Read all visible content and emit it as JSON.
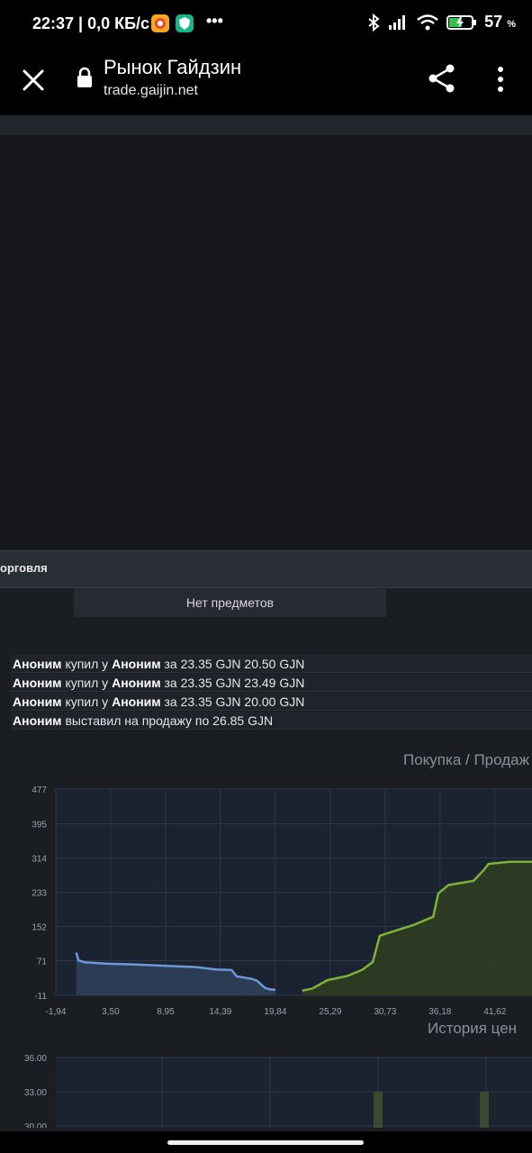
{
  "status_bar": {
    "time": "22:37",
    "speed": "0,0 КБ/с",
    "dots": "•••",
    "battery": "57",
    "battery_unit": "%"
  },
  "browser": {
    "title": "Рынок Гайдзин",
    "url": "trade.gaijin.net"
  },
  "trade_section": {
    "header": "орговля",
    "no_items": "Нет предметов"
  },
  "history": [
    {
      "user1": "Аноним",
      "action": "купил у",
      "user2": "Аноним",
      "rest": "за 23.35 GJN 20.50 GJN"
    },
    {
      "user1": "Аноним",
      "action": "купил у",
      "user2": "Аноним",
      "rest": "за 23.35 GJN 23.49 GJN"
    },
    {
      "user1": "Аноним",
      "action": "купил у",
      "user2": "Аноним",
      "rest": "за 23.35 GJN 20.00 GJN"
    },
    {
      "user1": "Аноним",
      "action": "выставил на продажу по 26.85 GJN",
      "user2": "",
      "rest": ""
    }
  ],
  "colors": {
    "buy_line": "#6e98d8",
    "buy_fill": "#2e3f5a",
    "sell_line": "#7fb23a",
    "sell_fill": "#2f3d22",
    "bar": "#3a4a2e"
  },
  "chart_data": [
    {
      "type": "area",
      "title": "Покупка / Продаж",
      "y_ticks": [
        "477",
        "395",
        "314",
        "233",
        "152",
        "71",
        "-11"
      ],
      "x_ticks": [
        "-1,94",
        "3,50",
        "8,95",
        "14,39",
        "19,84",
        "25,29",
        "30,73",
        "36,18",
        "41,62"
      ],
      "ylim": [
        -11,
        477
      ],
      "xlim": [
        -1.94,
        45.3
      ],
      "series": [
        {
          "x": [
            0.1,
            0.3,
            1.0,
            3.0,
            6.0,
            9.0,
            12.0,
            14.0,
            15.5,
            16.0,
            17.5,
            18.0,
            18.8,
            19.3,
            19.84
          ],
          "y": [
            90,
            72,
            67,
            64,
            62,
            59,
            56,
            50,
            49,
            34,
            28,
            24,
            7,
            3,
            2
          ]
        },
        {
          "x": [
            22.5,
            23.5,
            25.0,
            27.0,
            28.5,
            29.5,
            30.2,
            31.5,
            33.5,
            35.5,
            36.0,
            37.0,
            39.5,
            40.5,
            41.0,
            43.0,
            45.3
          ],
          "y": [
            0,
            5,
            25,
            35,
            50,
            68,
            130,
            140,
            155,
            175,
            230,
            250,
            260,
            285,
            300,
            305,
            305
          ]
        }
      ]
    },
    {
      "type": "bar",
      "title": "История цен",
      "y_ticks": [
        "36.00",
        "33.00",
        "30.00"
      ],
      "series": [
        {
          "values": [
            33.0,
            33.0
          ]
        }
      ]
    }
  ]
}
